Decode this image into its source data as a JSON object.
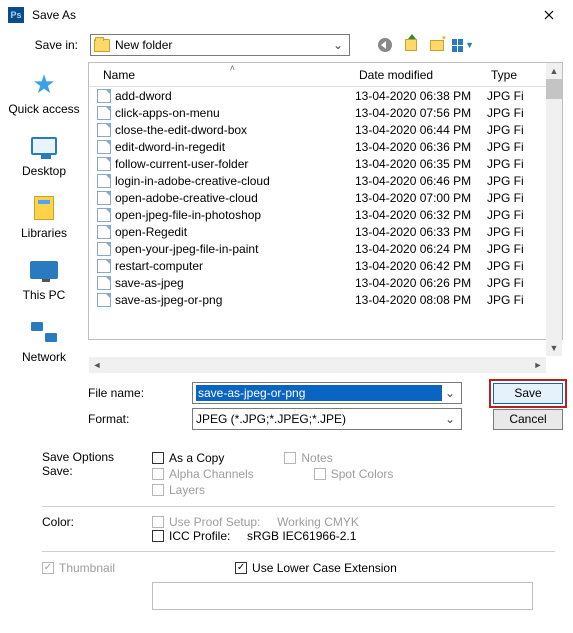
{
  "title": "Save As",
  "savein": {
    "label": "Save in:",
    "value": "New folder"
  },
  "columns": {
    "name": "Name",
    "date": "Date modified",
    "type": "Type"
  },
  "files": [
    {
      "name": "add-dword",
      "date": "13-04-2020 06:38 PM",
      "type": "JPG Fi"
    },
    {
      "name": "click-apps-on-menu",
      "date": "13-04-2020 07:56 PM",
      "type": "JPG Fi"
    },
    {
      "name": "close-the-edit-dword-box",
      "date": "13-04-2020 06:44 PM",
      "type": "JPG Fi"
    },
    {
      "name": "edit-dword-in-regedit",
      "date": "13-04-2020 06:36 PM",
      "type": "JPG Fi"
    },
    {
      "name": "follow-current-user-folder",
      "date": "13-04-2020 06:35 PM",
      "type": "JPG Fi"
    },
    {
      "name": "login-in-adobe-creative-cloud",
      "date": "13-04-2020 06:46 PM",
      "type": "JPG Fi"
    },
    {
      "name": "open-adobe-creative-cloud",
      "date": "13-04-2020 07:00 PM",
      "type": "JPG Fi"
    },
    {
      "name": "open-jpeg-file-in-photoshop",
      "date": "13-04-2020 06:32 PM",
      "type": "JPG Fi"
    },
    {
      "name": "open-Regedit",
      "date": "13-04-2020 06:33 PM",
      "type": "JPG Fi"
    },
    {
      "name": "open-your-jpeg-file-in-paint",
      "date": "13-04-2020 06:24 PM",
      "type": "JPG Fi"
    },
    {
      "name": "restart-computer",
      "date": "13-04-2020 06:42 PM",
      "type": "JPG Fi"
    },
    {
      "name": "save-as-jpeg",
      "date": "13-04-2020 06:26 PM",
      "type": "JPG Fi"
    },
    {
      "name": "save-as-jpeg-or-png",
      "date": "13-04-2020 08:08 PM",
      "type": "JPG Fi"
    }
  ],
  "places": {
    "quick": "Quick access",
    "desktop": "Desktop",
    "libs": "Libraries",
    "pc": "This PC",
    "net": "Network"
  },
  "filename": {
    "label": "File name:",
    "value": "save-as-jpeg-or-png"
  },
  "format": {
    "label": "Format:",
    "value": "JPEG (*.JPG;*.JPEG;*.JPE)"
  },
  "buttons": {
    "save": "Save",
    "cancel": "Cancel"
  },
  "opts": {
    "header": "Save Options",
    "save_label": "Save:",
    "as_copy": "As a Copy",
    "notes": "Notes",
    "alpha": "Alpha Channels",
    "spot": "Spot Colors",
    "layers": "Layers",
    "color_label": "Color:",
    "proof": "Use Proof Setup:",
    "proof_value": "Working CMYK",
    "icc": "ICC Profile:",
    "icc_value": "sRGB IEC61966-2.1",
    "thumb": "Thumbnail",
    "lower": "Use Lower Case Extension"
  }
}
